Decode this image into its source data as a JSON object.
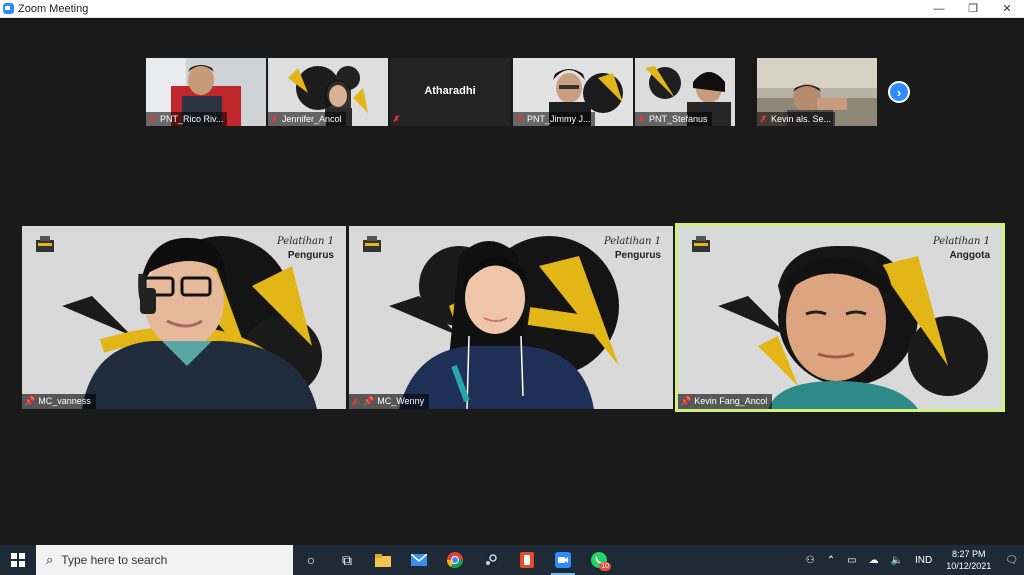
{
  "window": {
    "title": "Zoom Meeting",
    "minimize": "—",
    "maximize": "❐",
    "close": "✕"
  },
  "gallery_strip": [
    {
      "name": "PNT_Rico Riv...",
      "type": "video"
    },
    {
      "name": "Jennifer_Ancol",
      "type": "video"
    },
    {
      "name": "",
      "center_label": "Atharadhi",
      "type": "no-video"
    },
    {
      "name": "PNT_Jimmy J...",
      "type": "video"
    },
    {
      "name": "PNT_Stefanus",
      "type": "video"
    },
    {
      "name": "Kevin als. Se...",
      "type": "video"
    }
  ],
  "next_page_icon": "chevron-right-icon",
  "main_tiles": [
    {
      "name": "MC_vanness",
      "banner_title": "Pelatihan 1",
      "banner_sub": "Pengurus",
      "muted": false
    },
    {
      "name": "MC_Wenny",
      "banner_title": "Pelatihan 1",
      "banner_sub": "Pengurus",
      "muted": true
    },
    {
      "name": "Kevin Fang_Ancol",
      "banner_title": "Pelatihan 1",
      "banner_sub": "Anggota",
      "muted": false,
      "active_speaker": true
    }
  ],
  "taskbar": {
    "search_placeholder": "Type here to search",
    "apps": [
      "cortana-icon",
      "task-view-icon",
      "file-explorer-icon",
      "mail-icon",
      "chrome-icon",
      "steam-icon",
      "office-icon",
      "zoom-icon",
      "whatsapp-icon"
    ],
    "whatsapp_badge": "10",
    "language": "IND",
    "time": "8:27 PM",
    "date": "10/12/2021"
  },
  "colors": {
    "accent": "#2d8cff",
    "active_speaker_border": "#d6ef7a",
    "background": "#1a1a1a",
    "taskbar": "#1e2b37"
  }
}
